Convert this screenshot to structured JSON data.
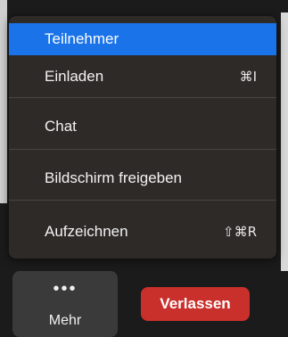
{
  "menu": {
    "items": [
      {
        "label": "Teilnehmer",
        "shortcut": "",
        "selected": true
      },
      {
        "label": "Einladen",
        "shortcut": "⌘I",
        "selected": false
      },
      {
        "label": "Chat",
        "shortcut": "",
        "selected": false
      },
      {
        "label": "Bildschirm freigeben",
        "shortcut": "",
        "selected": false
      },
      {
        "label": "Aufzeichnen",
        "shortcut": "⇧⌘R",
        "selected": false
      }
    ]
  },
  "toolbar": {
    "more_icon": "ellipsis-icon",
    "more_label": "Mehr",
    "leave_label": "Verlassen"
  },
  "colors": {
    "selected": "#1a73e8",
    "menu_bg": "#2e2a28",
    "leave": "#c9302c"
  }
}
